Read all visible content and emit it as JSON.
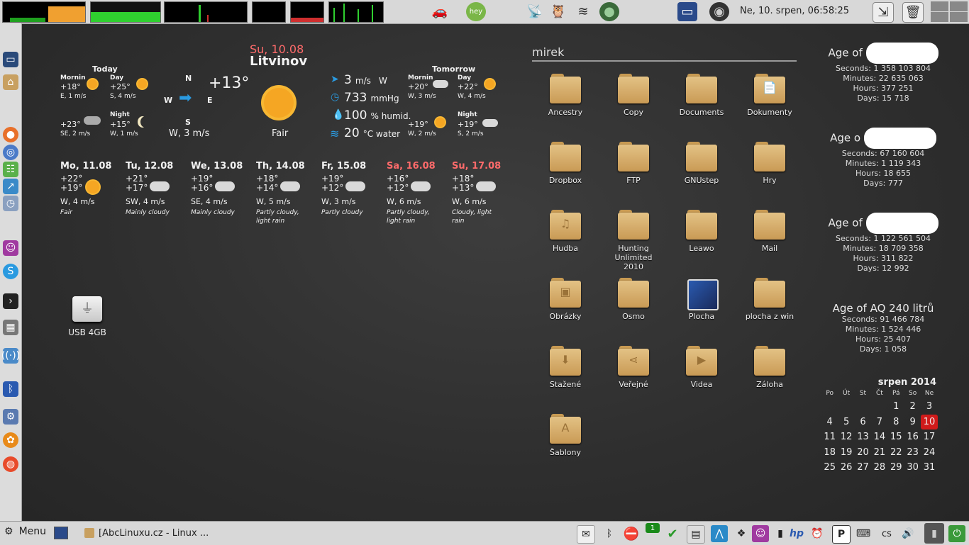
{
  "top_panel": {
    "clock": "Ne, 10. srpen, 06:58:25",
    "tray_icons": [
      "car-icon",
      "hey-icon",
      "antenna-icon",
      "owl-icon",
      "wifi-icon",
      "globe-icon",
      "lock-screen-icon",
      "camera-icon",
      "window-switch-icon",
      "trash-icon",
      "workspace-icon"
    ]
  },
  "weather": {
    "date": "Su, 10.08",
    "city": "Litvinov",
    "current_temp": "+13°",
    "compass": {
      "n": "N",
      "s": "S",
      "w": "W",
      "e": "E"
    },
    "current_wind": "W, 3 m/s",
    "condition": "Fair",
    "today": {
      "label": "Today",
      "morning_label": "Mornin",
      "morning_temp": "+18°",
      "morning_wind": "E, 1 m/s",
      "day_label": "Day",
      "day_temp": "+25°",
      "day_wind": "S, 4 m/s",
      "evening_temp": "+23°",
      "evening_wind": "SE, 2 m/s",
      "night_label": "Night",
      "night_temp": "+15°",
      "night_wind": "W, 1 m/s"
    },
    "stats": {
      "wind_value": "3",
      "wind_unit": "m/s",
      "wind_dir": "W",
      "pressure_value": "733",
      "pressure_unit": "mmHg",
      "humidity_value": "100",
      "humidity_unit": "% humid.",
      "water_value": "20",
      "water_unit": "°C water"
    },
    "tomorrow": {
      "label": "Tomorrow",
      "morning_label": "Mornin",
      "morning_temp": "+20°",
      "morning_wind": "W, 3 m/s",
      "day_label": "Day",
      "day_temp": "+22°",
      "day_wind": "W, 4 m/s",
      "evening_temp": "+19°",
      "evening_wind": "W, 2 m/s",
      "night_label": "Night",
      "night_temp": "+19°",
      "night_wind": "S, 2 m/s"
    },
    "forecast": [
      {
        "day": "Mo, 11.08",
        "high": "+22°",
        "low": "+19°",
        "wind": "W, 4 m/s",
        "cond": "Fair",
        "weekend": false
      },
      {
        "day": "Tu, 12.08",
        "high": "+21°",
        "low": "+17°",
        "wind": "SW, 4 m/s",
        "cond": "Mainly cloudy",
        "weekend": false
      },
      {
        "day": "We, 13.08",
        "high": "+19°",
        "low": "+16°",
        "wind": "SE, 4 m/s",
        "cond": "Mainly cloudy",
        "weekend": false
      },
      {
        "day": "Th, 14.08",
        "high": "+18°",
        "low": "+14°",
        "wind": "W, 5 m/s",
        "cond": "Partly cloudy, light rain",
        "weekend": false
      },
      {
        "day": "Fr, 15.08",
        "high": "+19°",
        "low": "+12°",
        "wind": "W, 3 m/s",
        "cond": "Partly cloudy",
        "weekend": false
      },
      {
        "day": "Sa, 16.08",
        "high": "+16°",
        "low": "+12°",
        "wind": "W, 6 m/s",
        "cond": "Partly cloudy, light rain",
        "weekend": true
      },
      {
        "day": "Su, 17.08",
        "high": "+18°",
        "low": "+13°",
        "wind": "W, 6 m/s",
        "cond": "Cloudy, light rain",
        "weekend": true
      }
    ]
  },
  "folders": {
    "header": "mirek",
    "items": [
      {
        "label": "Ancestry",
        "glyph": ""
      },
      {
        "label": "Copy",
        "glyph": ""
      },
      {
        "label": "Documents",
        "glyph": ""
      },
      {
        "label": "Dokumenty",
        "glyph": "📄"
      },
      {
        "label": "Dropbox",
        "glyph": ""
      },
      {
        "label": "FTP",
        "glyph": ""
      },
      {
        "label": "GNUstep",
        "glyph": ""
      },
      {
        "label": "Hry",
        "glyph": ""
      },
      {
        "label": "Hudba",
        "glyph": "♫"
      },
      {
        "label": "Hunting Unlimited 2010",
        "glyph": ""
      },
      {
        "label": "Leawo",
        "glyph": ""
      },
      {
        "label": "Mail",
        "glyph": ""
      },
      {
        "label": "Obrázky",
        "glyph": "▣"
      },
      {
        "label": "Osmo",
        "glyph": ""
      },
      {
        "label": "Plocha",
        "glyph": "desktop"
      },
      {
        "label": "plocha z win",
        "glyph": ""
      },
      {
        "label": "Stažené",
        "glyph": "⬇"
      },
      {
        "label": "Veřejné",
        "glyph": "⋖"
      },
      {
        "label": "Videa",
        "glyph": "▶"
      },
      {
        "label": "Záloha",
        "glyph": ""
      },
      {
        "label": "Šablony",
        "glyph": "A"
      }
    ]
  },
  "usb": {
    "label": "USB 4GB"
  },
  "ages": [
    {
      "title": "Age of",
      "seconds": "Seconds: 1 358 103 804",
      "minutes": "Minutes: 22 635 063",
      "hours": "Hours: 377 251",
      "days": "Days: 15 718",
      "redacted": true
    },
    {
      "title": "Age o",
      "seconds": "Seconds: 67 160 604",
      "minutes": "Minutes: 1 119 343",
      "hours": "Hours: 18 655",
      "days": "Days: 777",
      "redacted": true
    },
    {
      "title": "Age of",
      "seconds": "Seconds: 1 122 561 504",
      "minutes": "Minutes: 18 709 358",
      "hours": "Hours: 311 822",
      "days": "Days: 12 992",
      "redacted": true
    },
    {
      "title": "Age of AQ 240 litrů",
      "seconds": "Seconds: 91 466 784",
      "minutes": "Minutes: 1 524 446",
      "hours": "Hours: 25 407",
      "days": "Days: 1 058",
      "redacted": false
    }
  ],
  "calendar": {
    "title": "srpen 2014",
    "weekdays": [
      "Po",
      "Út",
      "St",
      "Čt",
      "Pá",
      "So",
      "Ne"
    ],
    "weeks": [
      [
        "",
        "",
        "",
        "",
        "1",
        "2",
        "3"
      ],
      [
        "4",
        "5",
        "6",
        "7",
        "8",
        "9",
        "10"
      ],
      [
        "11",
        "12",
        "13",
        "14",
        "15",
        "16",
        "17"
      ],
      [
        "18",
        "19",
        "20",
        "21",
        "22",
        "23",
        "24"
      ],
      [
        "25",
        "26",
        "27",
        "28",
        "29",
        "30",
        "31"
      ]
    ],
    "today": "10"
  },
  "bottom_panel": {
    "menu_label": "Menu",
    "task_label": "[AbcLinuxu.cz - Linux ...",
    "lang": "cs",
    "badge": "1",
    "tray_icons": [
      "stamp-icon",
      "bluetooth-icon",
      "no-entry-icon",
      "badge-icon",
      "check-icon",
      "screenshot-icon",
      "bird-icon",
      "dropbox-icon",
      "chat-icon",
      "battery-icon",
      "hp-icon",
      "alarm-icon",
      "parking-icon",
      "keyboard-icon",
      "volume-icon",
      "signal-icon",
      "power-icon"
    ]
  },
  "dock": {
    "items": [
      "monitor-icon",
      "home-icon",
      "firefox-icon",
      "chromium-icon",
      "rss-icon",
      "chart-icon",
      "clock-icon",
      "chat-icon",
      "skype-icon",
      "terminal-icon",
      "calculator-icon",
      "wifi-icon",
      "bluetooth-icon",
      "gear-icon",
      "flower-icon",
      "launch-icon"
    ]
  }
}
